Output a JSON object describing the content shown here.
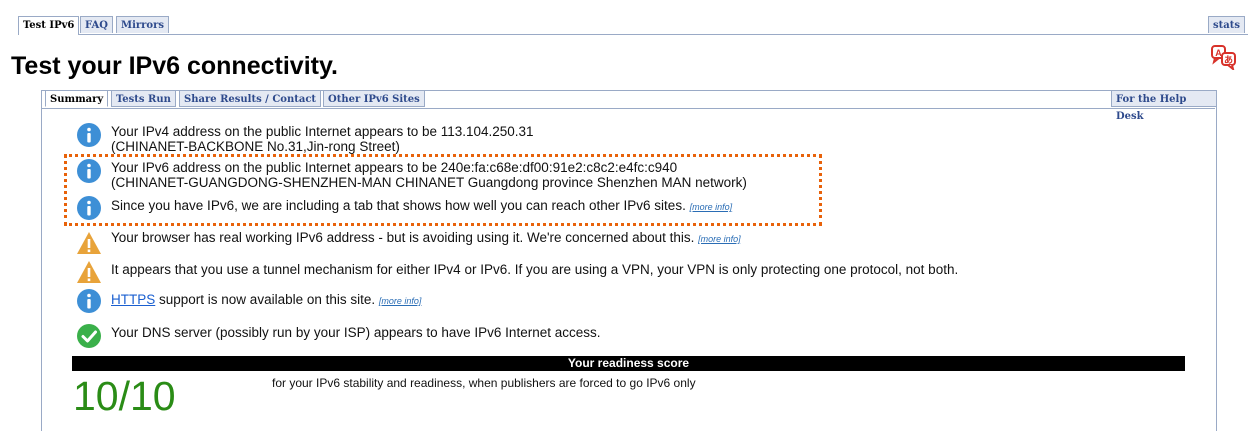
{
  "top_tabs": {
    "test_ipv6": "Test IPv6",
    "faq": "FAQ",
    "mirrors": "Mirrors",
    "stats": "stats"
  },
  "page_title": "Test your IPv6 connectivity.",
  "sub_tabs": {
    "summary": "Summary",
    "tests_run": "Tests Run",
    "share_results": "Share Results / Contact",
    "other_sites": "Other IPv6 Sites",
    "help_desk": "For the Help Desk"
  },
  "messages": {
    "ipv4_line1": "Your IPv4 address on the public Internet appears to be 113.104.250.31",
    "ipv4_line2": "(CHINANET-BACKBONE No.31,Jin-rong Street)",
    "ipv6_line1": "Your IPv6 address on the public Internet appears to be 240e:fa:c68e:df00:91e2:c8c2:e4fc:c940",
    "ipv6_line2": "(CHINANET-GUANGDONG-SHENZHEN-MAN CHINANET Guangdong province Shenzhen MAN network)",
    "tab_info": "Since you have IPv6, we are including a tab that shows how well you can reach other IPv6 sites.",
    "avoiding": "Your browser has real working IPv6 address - but is avoiding using it. We're concerned about this.",
    "tunnel": "It appears that you use a tunnel mechanism for either IPv4 or IPv6. If you are using a VPN, your VPN is only protecting one protocol, not both.",
    "https_link": "HTTPS",
    "https_rest": " support is now available on this site.",
    "dns": "Your DNS server (possibly run by your ISP) appears to have IPv6 Internet access."
  },
  "more_info": "[more info]",
  "readiness": {
    "header": "Your readiness score",
    "score": "10/10",
    "description": "for your IPv6 stability and readiness, when publishers are forced to go IPv6 only"
  },
  "icons": {
    "info": "info-icon",
    "warning": "warning-icon",
    "ok": "checkmark-icon",
    "translate": "translate-icon"
  },
  "colors": {
    "info_blue": "#3d8fd6",
    "warning_orange": "#e8a33a",
    "ok_green": "#3ab04a",
    "score_green": "#2a8c16",
    "highlight_orange": "#e8620a"
  }
}
